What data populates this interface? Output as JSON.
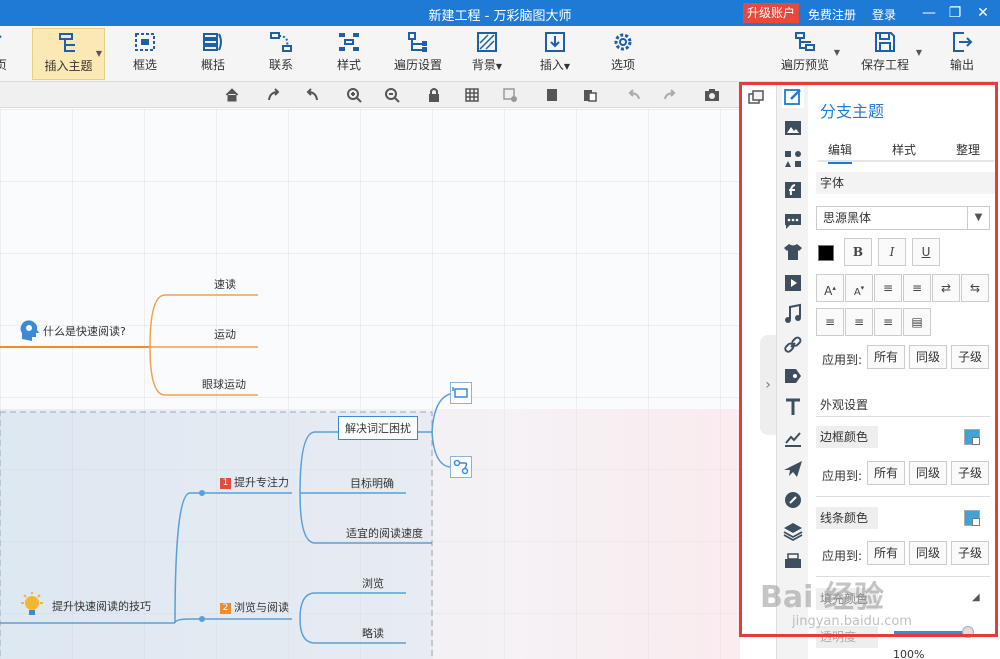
{
  "window": {
    "title": "新建工程 - 万彩脑图大师",
    "upgrade": "升级账户",
    "register": "免费注册",
    "login": "登录"
  },
  "ribbon": {
    "items": [
      {
        "label": "页",
        "icon": "home-icon"
      },
      {
        "label": "插入主题",
        "icon": "insert-topic-icon",
        "active": true
      },
      {
        "label": "框选",
        "icon": "box-select-icon"
      },
      {
        "label": "概括",
        "icon": "summary-icon"
      },
      {
        "label": "联系",
        "icon": "relationship-icon"
      },
      {
        "label": "样式",
        "icon": "style-icon"
      },
      {
        "label": "遍历设置",
        "icon": "traverse-settings-icon"
      },
      {
        "label": "背景",
        "icon": "background-icon"
      },
      {
        "label": "插入",
        "icon": "insert-icon"
      },
      {
        "label": "选项",
        "icon": "options-gear-icon"
      },
      {
        "label": "遍历预览",
        "icon": "traverse-preview-icon"
      },
      {
        "label": "保存工程",
        "icon": "save-icon"
      },
      {
        "label": "输出",
        "icon": "export-icon"
      }
    ]
  },
  "mindmap": {
    "topic1": "什么是快速阅读?",
    "topic1_children": [
      "速读",
      "运动",
      "眼球运动"
    ],
    "topic2": "提升快速阅读的技巧",
    "branch1": {
      "num": "1",
      "label": "提升专注力"
    },
    "branch1_children": [
      "解决词汇困扰",
      "目标明确",
      "适宜的阅读速度"
    ],
    "branch2": {
      "num": "2",
      "label": "浏览与阅读"
    },
    "branch2_children": [
      "浏览",
      "略读"
    ]
  },
  "panel": {
    "title": "分支主题",
    "tabs": [
      "编辑",
      "样式",
      "整理"
    ],
    "font_section": "字体",
    "font_name": "思源黑体",
    "bold": "B",
    "italic": "I",
    "underline": "U",
    "apply_to": "应用到:",
    "apply_options": [
      "所有",
      "同级",
      "子级"
    ],
    "appearance_section": "外观设置",
    "border_color": "边框颜色",
    "line_color": "线条颜色",
    "partial_label": "填充颜色",
    "partial_label2": "透明度",
    "accent": "#1f7ad6",
    "swatch_color": "#3fa3d8"
  },
  "watermark": {
    "text": "Bai 经验",
    "url": "jingyan.baidu.com"
  },
  "zoom": "100%"
}
